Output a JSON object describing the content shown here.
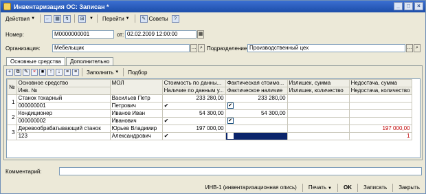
{
  "window": {
    "title": "Инвентаризация ОС: Записан *"
  },
  "toolbar": {
    "actions_label": "Действия",
    "goto_label": "Перейти",
    "tips_label": "Советы",
    "help_label": "?"
  },
  "header": {
    "number_label": "Номер:",
    "number_value": "М0000000001",
    "date_label": "от:",
    "date_value": "02.02.2009 12:00:00",
    "org_label": "Организация:",
    "org_value": "Мебельщик",
    "dept_label": "Подразделение:",
    "dept_value": "Производственный цех"
  },
  "tabs": [
    {
      "label": "Основные средства",
      "active": true
    },
    {
      "label": "Дополнительно",
      "active": false
    }
  ],
  "panel_toolbar": {
    "fill_label": "Заполнить",
    "select_label": "Подбор"
  },
  "table": {
    "headers_top": [
      "№",
      "Основное средство",
      "МОЛ",
      "Стоимость по данны...",
      "Фактическая стоимо...",
      "Излишек, сумма",
      "Недостача, сумма"
    ],
    "headers_bottom": [
      "Инв. №",
      "Наличие по данным у...",
      "Фактическое наличие",
      "Излишек, количество",
      "Недостача, количество"
    ],
    "rows": [
      {
        "n": "1",
        "asset": "Станок токарный",
        "inv": "000000001",
        "mol1": "Васильев Петр",
        "mol2": "Петрович",
        "book_cost": "233 280,00",
        "book_present": "✔",
        "fact_cost": "233 280,00",
        "fact_present": "✔",
        "surplus_sum": "",
        "surplus_qty": "",
        "short_sum": "",
        "short_qty": ""
      },
      {
        "n": "2",
        "asset": "Кондиционер",
        "inv": "000000002",
        "mol1": "Иванов Иван",
        "mol2": "Иванович",
        "book_cost": "54 300,00",
        "book_present": "✔",
        "fact_cost": "54 300,00",
        "fact_present": "✔",
        "surplus_sum": "",
        "surplus_qty": "",
        "short_sum": "",
        "short_qty": ""
      },
      {
        "n": "3",
        "asset": "Деревообрабатывающий станок",
        "inv": "123",
        "mol1": "Юрьев Владимир",
        "mol2": "Александрович",
        "book_cost": "197 000,00",
        "book_present": "✔",
        "fact_cost": "",
        "fact_present": "",
        "surplus_sum": "",
        "surplus_qty": "",
        "short_sum": "197 000,00",
        "short_qty": "1"
      }
    ]
  },
  "comment": {
    "label": "Комментарий:",
    "value": ""
  },
  "footer": {
    "inv1_label": "ИНВ-1 (инвентаризационная опись)",
    "print_label": "Печать",
    "ok_label": "OK",
    "save_label": "Записать",
    "close_label": "Закрыть"
  },
  "colors": {
    "title_bg": "#1d4eaa",
    "window_bg": "#ece9d8",
    "shortage_red": "#c00000",
    "selection": "#0a246a"
  }
}
